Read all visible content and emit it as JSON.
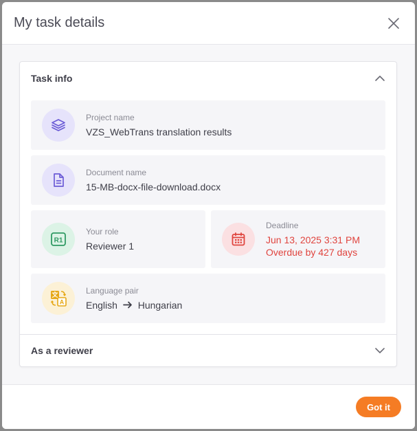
{
  "dialog": {
    "title": "My task details",
    "got_it_label": "Got it"
  },
  "task_info": {
    "heading": "Task info",
    "project": {
      "label": "Project name",
      "value": "VZS_WebTrans translation results"
    },
    "document": {
      "label": "Document name",
      "value": "15-MB-docx-file-download.docx"
    },
    "role": {
      "label": "Your role",
      "value": "Reviewer 1",
      "badge": "R1"
    },
    "deadline": {
      "label": "Deadline",
      "date": "Jun 13, 2025 3:31 PM",
      "overdue": "Overdue by 427 days"
    },
    "language": {
      "label": "Language pair",
      "source": "English",
      "target": "Hungarian"
    }
  },
  "reviewer_section": {
    "heading": "As a reviewer"
  },
  "colors": {
    "accent": "#f57c24",
    "overdue": "#e0443e",
    "purple_icon": "#6b5bd6",
    "green_icon": "#2f9a63",
    "red_icon": "#e0443e",
    "yellow_icon": "#e6a817"
  },
  "icons": {
    "close": "close-icon",
    "project": "layers-icon",
    "document": "document-icon",
    "role": "role-badge-icon",
    "deadline": "calendar-icon",
    "language": "translate-icon",
    "expand": "chevron-up-icon",
    "collapse": "chevron-down-icon"
  }
}
